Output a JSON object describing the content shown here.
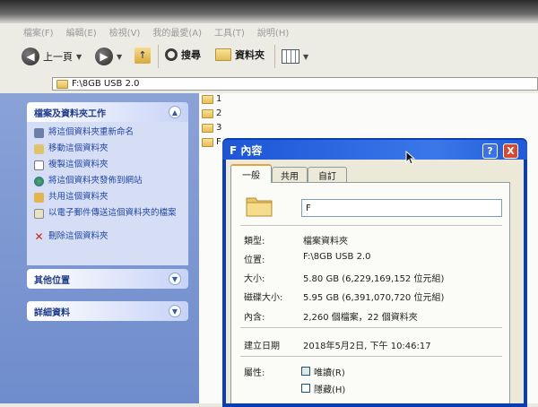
{
  "menubar": {
    "items": [
      "檔案(F)",
      "編輯(E)",
      "檢視(V)",
      "我的最愛(A)",
      "工具(T)",
      "說明(H)"
    ]
  },
  "toolbar": {
    "back_label": "上一頁",
    "search_label": "搜尋",
    "folders_label": "資料夾"
  },
  "addressbar": {
    "path": "F:\\8GB USB 2.0"
  },
  "tasks_panel": {
    "title": "檔案及資料夾工作",
    "items": [
      {
        "label": "將這個資料夾重新命名",
        "icon": "rename-icon"
      },
      {
        "label": "移動這個資料夾",
        "icon": "move-icon"
      },
      {
        "label": "複製這個資料夾",
        "icon": "copy-icon"
      },
      {
        "label": "將這個資料夾發佈到網站",
        "icon": "publish-icon"
      },
      {
        "label": "共用這個資料夾",
        "icon": "share-icon"
      },
      {
        "label": "以電子郵件傳送這個資料夾的檔案",
        "icon": "email-icon"
      },
      {
        "label": "刪除這個資料夾",
        "icon": "delete-icon"
      }
    ]
  },
  "other_places": {
    "title": "其他位置"
  },
  "details": {
    "title": "詳細資料"
  },
  "folders": [
    "1",
    "2",
    "3",
    "F"
  ],
  "dialog": {
    "title": "F 內容",
    "help": "?",
    "close": "X",
    "tabs": [
      "一般",
      "共用",
      "自訂"
    ],
    "name": "F",
    "props": [
      {
        "label": "類型:",
        "value": "檔案資料夾"
      },
      {
        "label": "位置:",
        "value": "F:\\8GB USB 2.0"
      },
      {
        "label": "大小:",
        "value": "5.80 GB (6,229,169,152 位元組)"
      },
      {
        "label": "磁碟大小:",
        "value": "5.95 GB (6,391,070,720 位元組)"
      },
      {
        "label": "內含:",
        "value": "2,260 個檔案，22 個資料夾"
      }
    ],
    "created": {
      "label": "建立日期",
      "value": "2018年5月2日, 下午 10:46:17"
    },
    "attributes": {
      "label": "屬性:",
      "readonly": "唯讀(R)",
      "hidden": "隱藏(H)"
    },
    "colors": {
      "titlebar": "#2a66e0",
      "tab_highlight": "#e6a23c"
    }
  }
}
